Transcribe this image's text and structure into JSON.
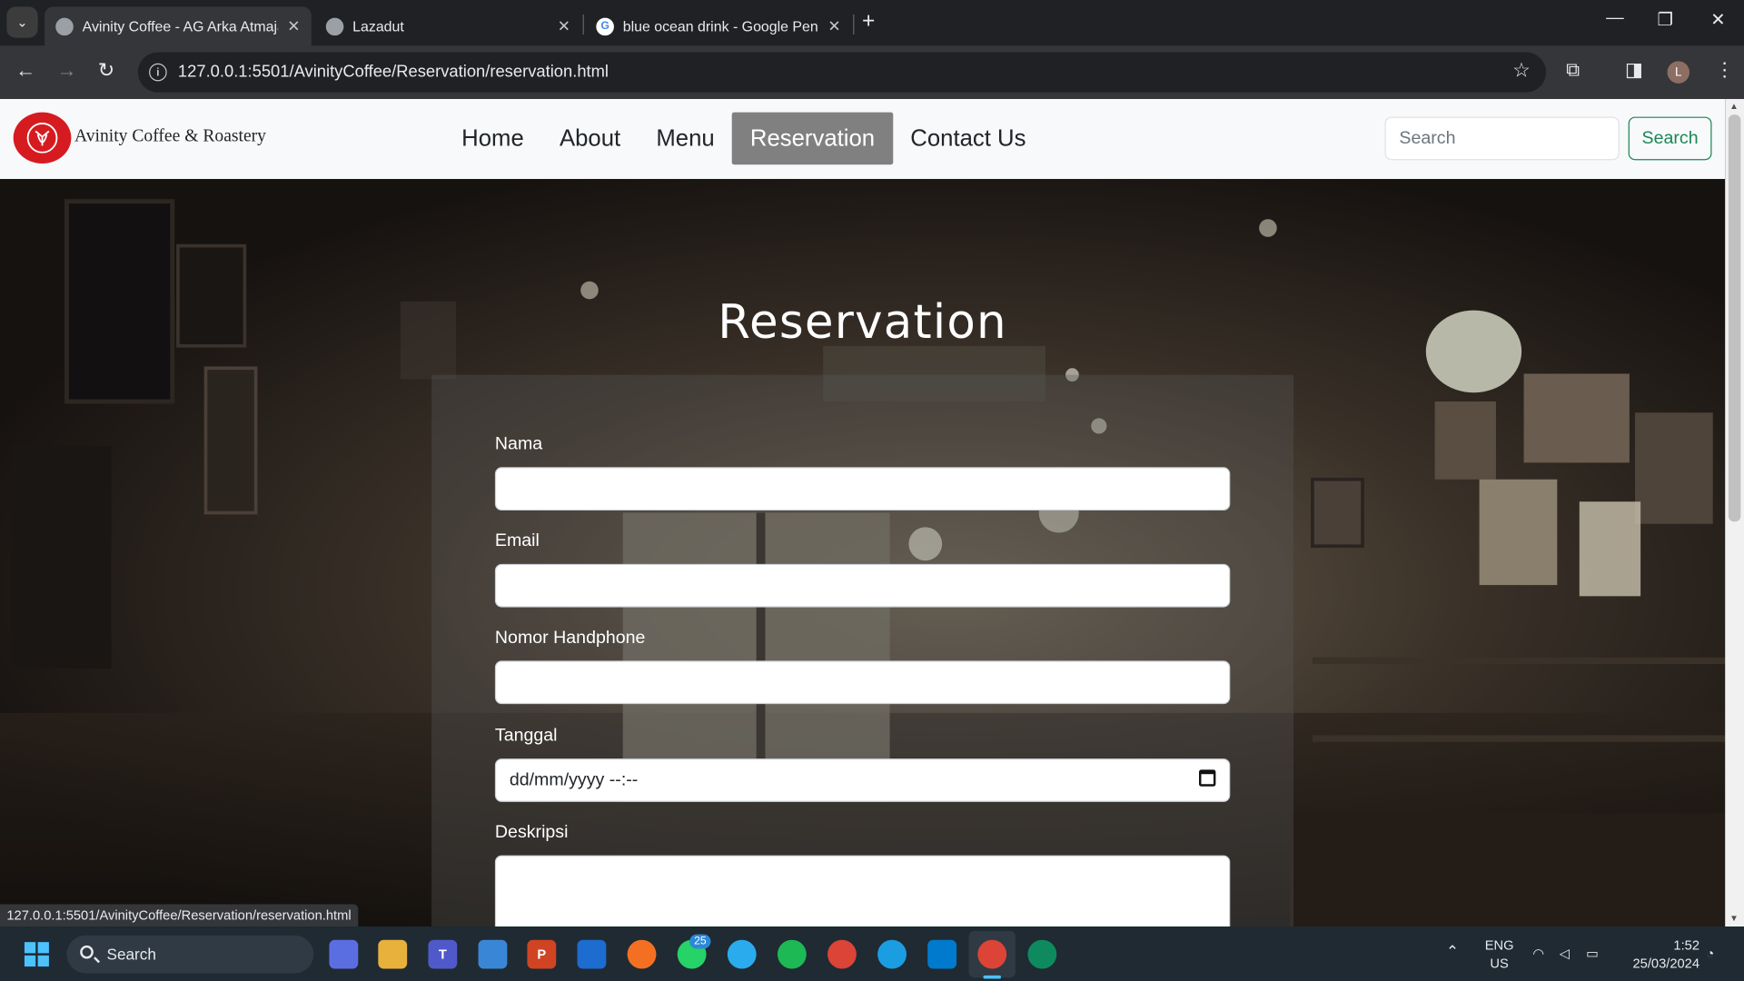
{
  "browser": {
    "tabs": [
      {
        "title": "Avinity Coffee - AG Arka Atmaja",
        "active": true
      },
      {
        "title": "Lazadut",
        "active": false
      },
      {
        "title": "blue ocean drink - Google Penelusuran",
        "active": false
      }
    ],
    "url": "127.0.0.1:5501/AvinityCoffee/Reservation/reservation.html",
    "status_url": "127.0.0.1:5501/AvinityCoffee/Reservation/reservation.html",
    "profile_initial": "L"
  },
  "site": {
    "brand": "Avinity Coffee & Roastery",
    "menu": [
      {
        "label": "Home",
        "active": false
      },
      {
        "label": "About",
        "active": false
      },
      {
        "label": "Menu",
        "active": false
      },
      {
        "label": "Reservation",
        "active": true
      },
      {
        "label": "Contact Us",
        "active": false
      }
    ],
    "search_placeholder": "Search",
    "search_button": "Search"
  },
  "hero": {
    "title": "Reservation"
  },
  "form": {
    "fields": [
      {
        "label": "Nama",
        "value": ""
      },
      {
        "label": "Email",
        "value": ""
      },
      {
        "label": "Nomor Handphone",
        "value": ""
      },
      {
        "label": "Tanggal",
        "value": "dd/mm/yyyy --:--"
      },
      {
        "label": "Deskripsi",
        "value": ""
      }
    ]
  },
  "taskbar": {
    "search_label": "Search",
    "whatsapp_badge": "25",
    "lang": "ENG",
    "region": "US",
    "time": "1:52",
    "date": "25/03/2024"
  },
  "colors": {
    "accent_green": "#198754",
    "active_menu_bg": "#808080",
    "logo_red": "#d61b20"
  }
}
